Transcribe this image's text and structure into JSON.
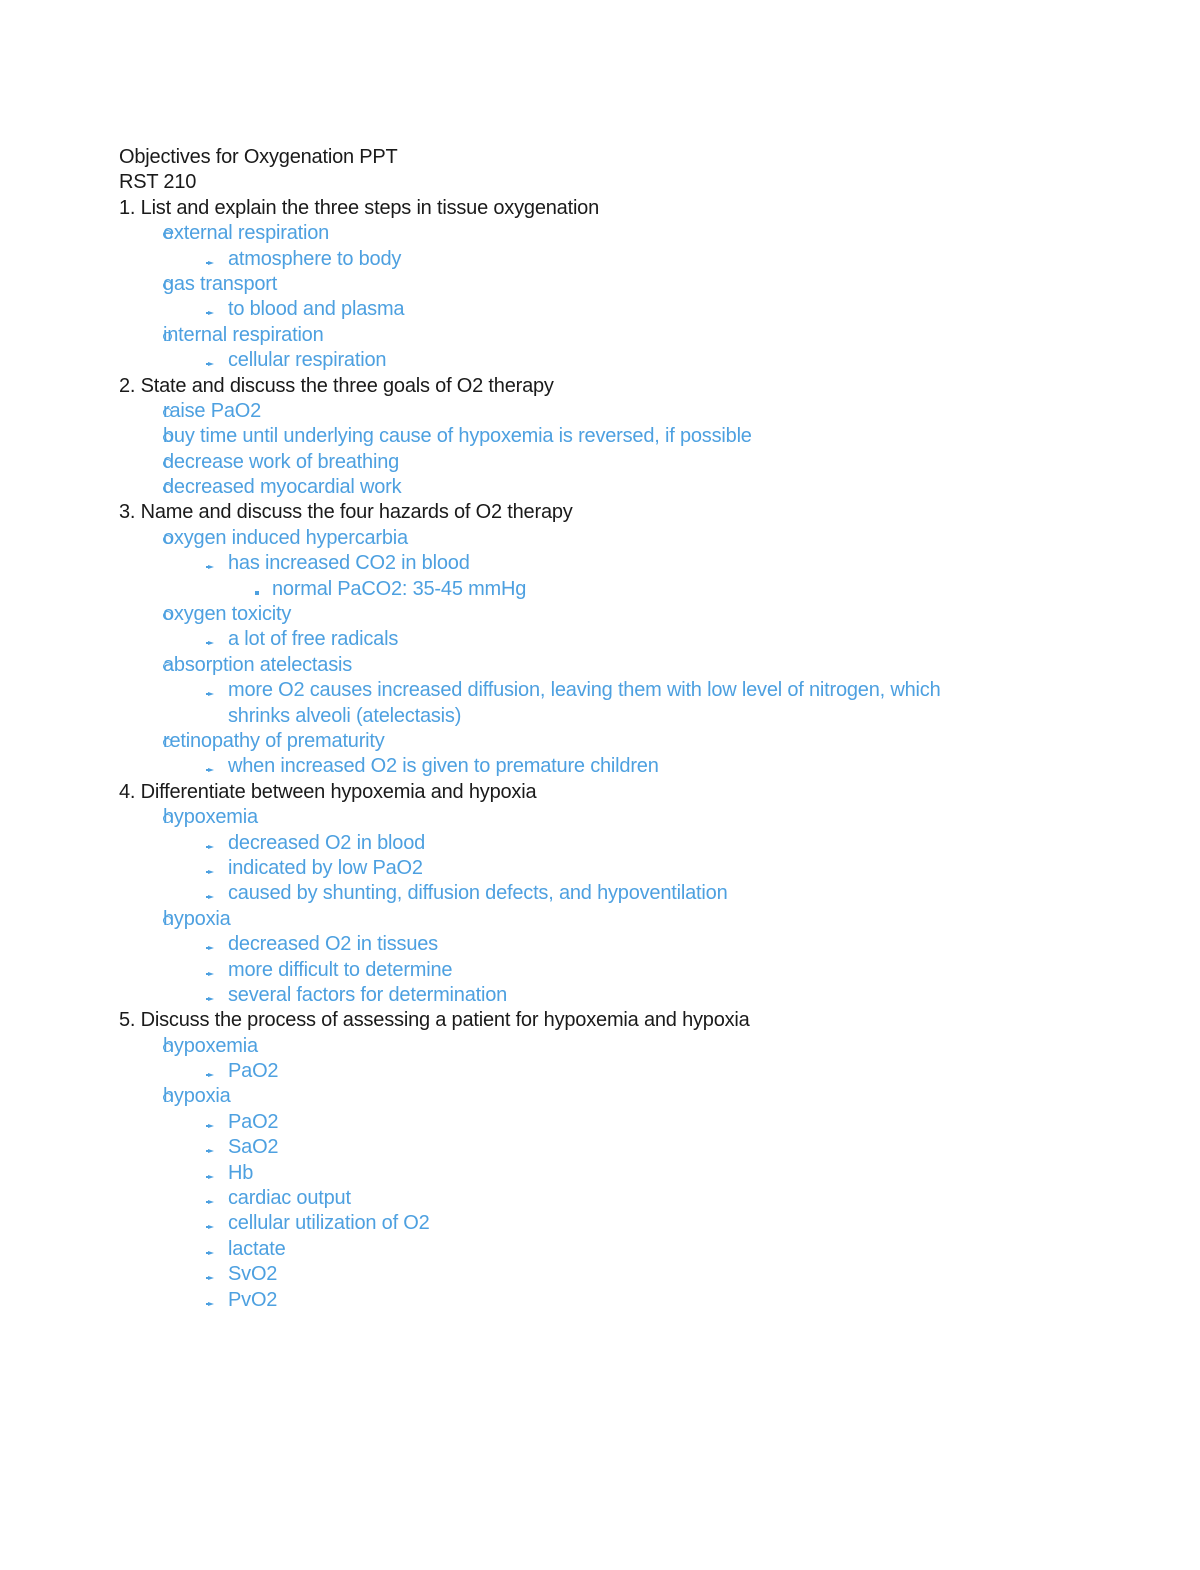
{
  "document": {
    "title": "Objectives for Oxygenation PPT",
    "course": "RST 210",
    "colors": {
      "heading_text": "#1a1a1a",
      "answer_text": "#4da0e0"
    },
    "objectives": [
      {
        "number": "1.",
        "text": "List and explain the three steps in tissue oxygenation",
        "items": [
          {
            "text": "external respiration",
            "sub": [
              {
                "text": "atmosphere to body"
              }
            ]
          },
          {
            "text": "gas transport",
            "sub": [
              {
                "text": "to blood and plasma"
              }
            ]
          },
          {
            "text": "internal respiration",
            "sub": [
              {
                "text": "cellular respiration"
              }
            ]
          }
        ]
      },
      {
        "number": "2.",
        "text": "State and discuss the three goals of O2 therapy",
        "items": [
          {
            "text": "raise PaO2"
          },
          {
            "text": "buy time until underlying cause of hypoxemia is reversed, if possible"
          },
          {
            "text": "decrease work of breathing"
          },
          {
            "text": "decreased myocardial work"
          }
        ]
      },
      {
        "number": "3.",
        "text": "Name and discuss the four hazards of O2 therapy",
        "items": [
          {
            "text": "oxygen induced hypercarbia",
            "sub": [
              {
                "text": "has increased CO2 in blood",
                "sub": [
                  {
                    "text": "normal PaCO2: 35-45 mmHg"
                  }
                ]
              }
            ]
          },
          {
            "text": "oxygen toxicity",
            "sub": [
              {
                "text": "a lot of free radicals"
              }
            ]
          },
          {
            "text": "absorption atelectasis",
            "sub": [
              {
                "text": "more O2 causes increased diffusion, leaving them with low level of nitrogen, which",
                "continuation": "shrinks alveoli (atelectasis)"
              }
            ]
          },
          {
            "text": "retinopathy of prematurity",
            "sub": [
              {
                "text": "when increased O2 is given to premature children"
              }
            ]
          }
        ]
      },
      {
        "number": "4.",
        "text": "Differentiate between hypoxemia and hypoxia",
        "items": [
          {
            "text": "hypoxemia",
            "sub": [
              {
                "text": "decreased O2 in blood"
              },
              {
                "text": "indicated by low PaO2"
              },
              {
                "text": "caused by shunting, diffusion defects, and hypoventilation"
              }
            ]
          },
          {
            "text": "hypoxia",
            "sub": [
              {
                "text": "decreased O2 in tissues"
              },
              {
                "text": "more difficult to determine"
              },
              {
                "text": "several factors for determination"
              }
            ]
          }
        ]
      },
      {
        "number": "5.",
        "text": "Discuss the process of assessing a patient for hypoxemia and hypoxia",
        "items": [
          {
            "text": "hypoxemia",
            "sub": [
              {
                "text": "PaO2"
              }
            ]
          },
          {
            "text": "hypoxia",
            "sub": [
              {
                "text": "PaO2"
              },
              {
                "text": "SaO2"
              },
              {
                "text": "Hb"
              },
              {
                "text": "cardiac output"
              },
              {
                "text": "cellular utilization of O2"
              },
              {
                "text": "lactate"
              },
              {
                "text": "SvO2"
              },
              {
                "text": "PvO2"
              }
            ]
          }
        ]
      }
    ]
  }
}
